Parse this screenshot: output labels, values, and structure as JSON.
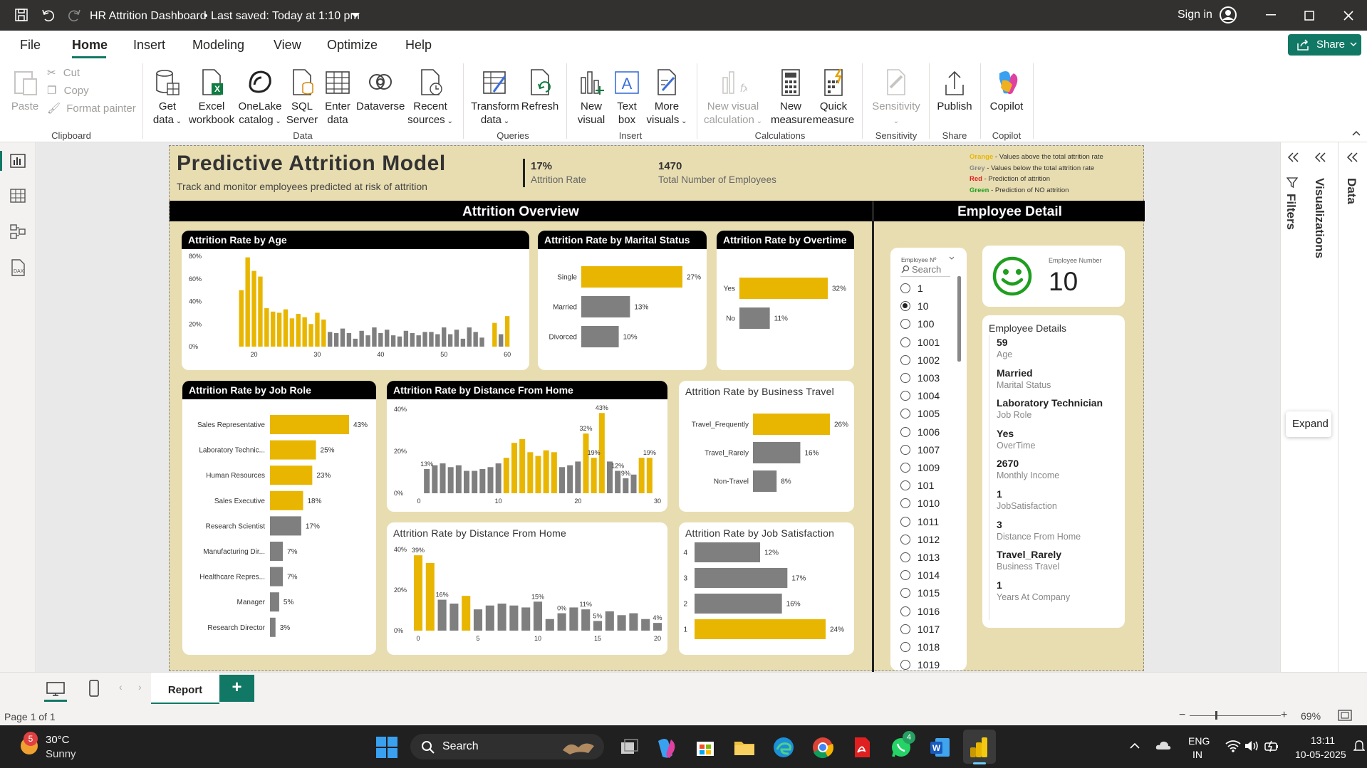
{
  "app": {
    "title": "HR Attrition Dashboard",
    "saved": "•  Last saved: Today at 1:10 pm",
    "sign_in": "Sign in",
    "share": "Share"
  },
  "menu": [
    "File",
    "Home",
    "Insert",
    "Modeling",
    "View",
    "Optimize",
    "Help"
  ],
  "ribbon": {
    "paste": "Paste",
    "cut": "Cut",
    "copy": "Copy",
    "format_painter": "Format painter",
    "clipboard": "Clipboard",
    "get_data": [
      "Get",
      "data"
    ],
    "excel": [
      "Excel",
      "workbook"
    ],
    "onelake": [
      "OneLake",
      "catalog"
    ],
    "sql": [
      "SQL",
      "Server"
    ],
    "enter": [
      "Enter",
      "data"
    ],
    "dataverse": [
      "Dataverse",
      ""
    ],
    "recent": [
      "Recent",
      "sources"
    ],
    "data_grp": "Data",
    "transform": [
      "Transform",
      "data"
    ],
    "refresh": [
      "Refresh",
      ""
    ],
    "queries_grp": "Queries",
    "new_visual": [
      "New",
      "visual"
    ],
    "text_box": [
      "Text",
      "box"
    ],
    "more_visuals": [
      "More",
      "visuals"
    ],
    "insert_grp": "Insert",
    "new_visual_calc": [
      "New visual",
      "calculation"
    ],
    "new_measure": [
      "New",
      "measure"
    ],
    "quick_measure": [
      "Quick",
      "measure"
    ],
    "calc_grp": "Calculations",
    "sensitivity": [
      "Sensitivity",
      ""
    ],
    "sens_grp": "Sensitivity",
    "publish": [
      "Publish",
      ""
    ],
    "share_grp": "Share",
    "copilot": [
      "Copilot",
      ""
    ],
    "copilot_grp": "Copilot"
  },
  "report": {
    "title": "Predictive Attrition Model",
    "subtitle": "Track and monitor employees predicted at risk of attrition",
    "kpi1_value": "17%",
    "kpi1_label": "Attrition Rate",
    "kpi2_value": "1470",
    "kpi2_label": "Total Number of Employees",
    "legend": [
      {
        "word": "Orange",
        "rest": " - Values above the total attrition rate",
        "color": "#e8b600"
      },
      {
        "word": "Grey",
        "rest": " - Values below the total attrition rate",
        "color": "#888888"
      },
      {
        "word": "Red",
        "rest": " - Prediction of attrition",
        "color": "#e02020"
      },
      {
        "word": "Green",
        "rest": " - Prediction of NO attrition",
        "color": "#1f9e1f"
      }
    ],
    "overview_header": "Attrition Overview",
    "detail_header": "Employee Detail"
  },
  "colors": {
    "above": "#e8b600",
    "below": "#7f7f7f",
    "smile": "#1f9e1f"
  },
  "chart_data": [
    {
      "id": "age",
      "type": "bar",
      "title": "Attrition Rate by Age",
      "x": [
        18,
        19,
        20,
        21,
        22,
        23,
        24,
        25,
        26,
        27,
        28,
        29,
        30,
        31,
        32,
        33,
        34,
        35,
        36,
        37,
        38,
        39,
        40,
        41,
        42,
        43,
        44,
        45,
        46,
        47,
        48,
        49,
        50,
        51,
        52,
        53,
        54,
        55,
        56,
        57,
        58,
        59,
        60
      ],
      "values": [
        50,
        79,
        67,
        62,
        34,
        31,
        30,
        33,
        25,
        29,
        26,
        20,
        30,
        24,
        13,
        12,
        16,
        12,
        7,
        14,
        10,
        17,
        12,
        15,
        10,
        9,
        14,
        12,
        10,
        13,
        13,
        11,
        17,
        11,
        15,
        7,
        17,
        13,
        8,
        0,
        21,
        11,
        27
      ],
      "ylim": [
        0,
        80
      ],
      "yticks": [
        "0%",
        "20%",
        "40%",
        "60%",
        "80%"
      ],
      "xticks": [
        20,
        30,
        40,
        50,
        60
      ]
    },
    {
      "id": "marital",
      "type": "bar",
      "title": "Attrition Rate by Marital Status",
      "categories": [
        "Single",
        "Married",
        "Divorced"
      ],
      "values": [
        27,
        13,
        10
      ],
      "labels": [
        "27%",
        "13%",
        "10%"
      ]
    },
    {
      "id": "overtime",
      "type": "bar",
      "title": "Attrition Rate by Overtime",
      "categories": [
        "Yes",
        "No"
      ],
      "values": [
        32,
        11
      ],
      "labels": [
        "32%",
        "11%"
      ]
    },
    {
      "id": "jobrole",
      "type": "bar",
      "title": "Attrition Rate by Job Role",
      "categories": [
        "Sales Representative",
        "Laboratory Technic...",
        "Human Resources",
        "Sales Executive",
        "Research Scientist",
        "Manufacturing Dir...",
        "Healthcare Repres...",
        "Manager",
        "Research Director"
      ],
      "values": [
        43,
        25,
        23,
        18,
        17,
        7,
        7,
        5,
        3
      ],
      "labels": [
        "43%",
        "25%",
        "23%",
        "18%",
        "17%",
        "7%",
        "7%",
        "5%",
        "3%"
      ]
    },
    {
      "id": "distance1",
      "type": "bar",
      "title": "Attrition Rate by Distance From Home",
      "x": [
        1,
        2,
        3,
        4,
        5,
        6,
        7,
        8,
        9,
        10,
        11,
        12,
        13,
        14,
        15,
        16,
        17,
        18,
        19,
        20,
        21,
        22,
        23,
        24,
        25,
        26,
        27,
        28,
        29
      ],
      "values": [
        13,
        15,
        16,
        14,
        15,
        12,
        12,
        13,
        14,
        16,
        19,
        27,
        29,
        22,
        20,
        23,
        22,
        14,
        15,
        17,
        32,
        19,
        43,
        17,
        12,
        8,
        10,
        19,
        19
      ],
      "ylim": [
        0,
        45
      ],
      "yticks": [
        "0%",
        "20%",
        "40%"
      ],
      "xticks": [
        0,
        10,
        20,
        30
      ],
      "annotations": [
        {
          "x": 1,
          "label": "13%"
        },
        {
          "x": 21,
          "label": "32%"
        },
        {
          "x": 22,
          "label": "19%"
        },
        {
          "x": 23,
          "label": "43%"
        },
        {
          "x": 25,
          "label": "12%"
        },
        {
          "x": 26,
          "label": "9%"
        },
        {
          "x": 29,
          "label": "19%"
        }
      ]
    },
    {
      "id": "travel",
      "type": "bar",
      "title": "Attrition Rate by Business Travel",
      "categories": [
        "Travel_Frequently",
        "Travel_Rarely",
        "Non-Travel"
      ],
      "values": [
        26,
        16,
        8
      ],
      "labels": [
        "26%",
        "16%",
        "8%"
      ]
    },
    {
      "id": "distance2",
      "type": "bar",
      "title": "Attrition Rate by Distance From Home",
      "x": [
        0,
        1,
        2,
        3,
        4,
        5,
        6,
        7,
        8,
        9,
        10,
        11,
        12,
        13,
        14,
        15,
        16,
        17,
        18,
        19,
        20
      ],
      "values": [
        39,
        35,
        16,
        14,
        18,
        11,
        13,
        14,
        13,
        12,
        15,
        6,
        9,
        12,
        11,
        5,
        10,
        8,
        9,
        6,
        4
      ],
      "ylim": [
        0,
        42
      ],
      "yticks": [
        "0%",
        "20%",
        "40%"
      ],
      "xticks": [
        0,
        5,
        10,
        15,
        20
      ],
      "annotations": [
        {
          "x": 0,
          "label": "39%"
        },
        {
          "x": 2,
          "label": "16%"
        },
        {
          "x": 10,
          "label": "15%"
        },
        {
          "x": 12,
          "label": "0%"
        },
        {
          "x": 14,
          "label": "11%"
        },
        {
          "x": 15,
          "label": "5%"
        },
        {
          "x": 20,
          "label": "4%"
        }
      ]
    },
    {
      "id": "jobsat",
      "type": "bar",
      "title": "Attrition Rate by Job Satisfaction",
      "categories": [
        "4",
        "3",
        "2",
        "1"
      ],
      "values": [
        12,
        17,
        16,
        24
      ],
      "labels": [
        "12%",
        "17%",
        "16%",
        "24%"
      ]
    }
  ],
  "slicer": {
    "title": "Employee Nº",
    "search": "Search",
    "items": [
      "1",
      "10",
      "100",
      "1001",
      "1002",
      "1003",
      "1004",
      "1005",
      "1006",
      "1007",
      "1009",
      "101",
      "1010",
      "1011",
      "1012",
      "1013",
      "1014",
      "1015",
      "1016",
      "1017",
      "1018",
      "1019"
    ],
    "selected": "10"
  },
  "employee": {
    "number_label": "Employee Number",
    "number": "10",
    "details_title": "Employee Details",
    "fields": [
      {
        "v": "59",
        "l": "Age"
      },
      {
        "v": "Married",
        "l": "Marital Status"
      },
      {
        "v": "Laboratory Technician",
        "l": "Job Role"
      },
      {
        "v": "Yes",
        "l": "OverTime"
      },
      {
        "v": "2670",
        "l": "Monthly Income"
      },
      {
        "v": "1",
        "l": "JobSatisfaction"
      },
      {
        "v": "3",
        "l": "Distance From Home"
      },
      {
        "v": "Travel_Rarely",
        "l": "Business Travel"
      },
      {
        "v": "1",
        "l": "Years At Company"
      }
    ]
  },
  "panes": {
    "filters": "Filters",
    "visualizations": "Visualizations",
    "data": "Data",
    "expand": "Expand"
  },
  "tabs": {
    "report": "Report",
    "add": "+"
  },
  "status": {
    "page": "Page 1 of 1",
    "zoom": "69%"
  },
  "taskbar": {
    "weather_temp": "30°C",
    "weather_desc": "Sunny",
    "weather_badge": "5",
    "search": "Search",
    "lang1": "ENG",
    "lang2": "IN",
    "time": "13:11",
    "date": "10-05-2025",
    "whatsapp_badge": "4"
  }
}
